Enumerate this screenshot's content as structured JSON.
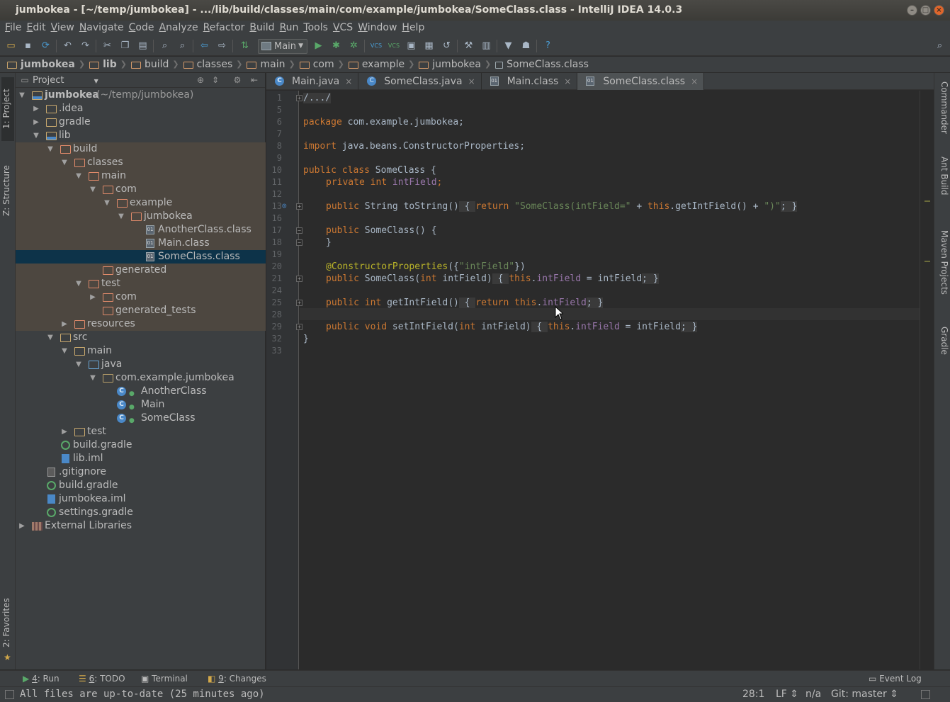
{
  "window": {
    "title": "jumbokea - [~/temp/jumbokea] - .../lib/build/classes/main/com/example/jumbokea/SomeClass.class - IntelliJ IDEA 14.0.3"
  },
  "menu": [
    "File",
    "Edit",
    "View",
    "Navigate",
    "Code",
    "Analyze",
    "Refactor",
    "Build",
    "Run",
    "Tools",
    "VCS",
    "Window",
    "Help"
  ],
  "toolbar": {
    "run_config": "Main",
    "vcs1": "VCS",
    "vcs2": "VCS",
    "help": "?"
  },
  "breadcrumbs": [
    "jumbokea",
    "lib",
    "build",
    "classes",
    "main",
    "com",
    "example",
    "jumbokea",
    "SomeClass.class"
  ],
  "left_stripe": {
    "project": "1: Project",
    "structure": "Z: Structure",
    "favorites": "2: Favorites"
  },
  "right_stripe": {
    "commander": "Commander",
    "ant_build": "Ant Build",
    "maven": "Maven Projects",
    "gradle": "Gradle"
  },
  "project_panel": {
    "title": "Project",
    "tree": [
      {
        "label": "jumbokea",
        "hint": " (~/temp/jumbokea)"
      },
      {
        "label": ".idea"
      },
      {
        "label": "gradle"
      },
      {
        "label": "lib"
      },
      {
        "label": "build"
      },
      {
        "label": "classes"
      },
      {
        "label": "main"
      },
      {
        "label": "com"
      },
      {
        "label": "example"
      },
      {
        "label": "jumbokea"
      },
      {
        "label": "AnotherClass.class"
      },
      {
        "label": "Main.class"
      },
      {
        "label": "SomeClass.class"
      },
      {
        "label": "generated"
      },
      {
        "label": "test"
      },
      {
        "label": "com"
      },
      {
        "label": "generated_tests"
      },
      {
        "label": "resources"
      },
      {
        "label": "src"
      },
      {
        "label": "main"
      },
      {
        "label": "java"
      },
      {
        "label": "com.example.jumbokea"
      },
      {
        "label": "AnotherClass"
      },
      {
        "label": "Main"
      },
      {
        "label": "SomeClass"
      },
      {
        "label": "test"
      },
      {
        "label": "build.gradle"
      },
      {
        "label": "lib.iml"
      },
      {
        "label": ".gitignore"
      },
      {
        "label": "build.gradle"
      },
      {
        "label": "jumbokea.iml"
      },
      {
        "label": "settings.gradle"
      },
      {
        "label": "External Libraries"
      }
    ]
  },
  "editor_tabs": [
    {
      "label": "Main.java",
      "active": false
    },
    {
      "label": "SomeClass.java",
      "active": false
    },
    {
      "label": "Main.class",
      "active": false
    },
    {
      "label": "SomeClass.class",
      "active": true
    }
  ],
  "editor": {
    "line_numbers": [
      "1",
      "5",
      "6",
      "7",
      "8",
      "9",
      "10",
      "11",
      "12",
      "13",
      "16",
      "17",
      "18",
      "19",
      "20",
      "21",
      "24",
      "25",
      "28",
      "29",
      "32",
      "33"
    ],
    "code": {
      "l1": "/.../",
      "l6_kw": "package",
      "l6_rest": " com.example.jumbokea;",
      "l8_kw": "import",
      "l8_rest": " java.beans.ConstructorProperties;",
      "l10_kw": "public class",
      "l10_rest": " SomeClass {",
      "l11_kw": "private int",
      "l11_fld": "intField",
      "l11_end": ";",
      "l13_kw": "public",
      "l13_a": " String toString()",
      "l13_fo": " { ",
      "l13_ret": "return",
      "l13_str": " \"SomeClass(intField=\"",
      "l13_b": " + ",
      "l13_this": "this",
      "l13_c": ".getIntField() + ",
      "l13_str2": "\")\"",
      "l13_fc": "; }",
      "l17_kw": "public",
      "l17_rest": " SomeClass() {",
      "l18": "}",
      "l20_ann": "@ConstructorProperties",
      "l20_a": "({",
      "l20_str": "\"intField\"",
      "l20_b": "})",
      "l21_kw": "public",
      "l21_a": " SomeClass(",
      "l21_kw2": "int",
      "l21_b": " intField)",
      "l21_fo": " { ",
      "l21_this": "this",
      "l21_c": ".",
      "l21_fld": "intField",
      "l21_d": " = intField",
      "l21_fc": "; }",
      "l25_kw": "public int",
      "l25_a": " getIntField()",
      "l25_fo": " { ",
      "l25_ret": "return this",
      "l25_b": ".",
      "l25_fld": "intField",
      "l25_fc": "; }",
      "l29_kw": "public void",
      "l29_a": " setIntField(",
      "l29_kw2": "int",
      "l29_b": " intField)",
      "l29_fo": " { ",
      "l29_this": "this",
      "l29_c": ".",
      "l29_fld": "intField",
      "l29_d": " = intField",
      "l29_fc": "; }",
      "l32": "}"
    }
  },
  "toolwindows": {
    "run_num": "4",
    "run": ": Run",
    "todo_num": "6",
    "todo": ": TODO",
    "terminal": "Terminal",
    "changes_num": "9",
    "changes": ": Changes",
    "event_log": "Event Log"
  },
  "status": {
    "message": "All files are up-to-date (25 minutes ago)",
    "position": "28:1",
    "line_sep": "LF",
    "encoding": "n/a",
    "vcs": "Git: master"
  },
  "colors": {
    "keyword": "#cc7832",
    "string": "#6a8759",
    "annotation": "#bbb529",
    "field": "#9876aa",
    "selection": "#0d3349"
  }
}
